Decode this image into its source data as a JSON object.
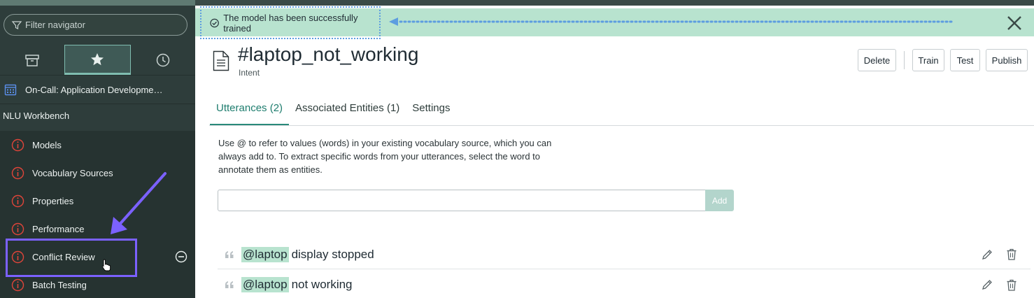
{
  "sidebar": {
    "filter_placeholder": "Filter navigator",
    "oncall_label": "On-Call: Application Developme…",
    "section_title": "NLU Workbench",
    "items": [
      {
        "label": "Models"
      },
      {
        "label": "Vocabulary Sources"
      },
      {
        "label": "Properties"
      },
      {
        "label": "Performance"
      },
      {
        "label": "Conflict Review"
      },
      {
        "label": "Batch Testing"
      }
    ]
  },
  "toast": {
    "message": "The model has been successfully trained"
  },
  "header": {
    "title": "#laptop_not_working",
    "subtitle": "Intent",
    "buttons": {
      "delete": "Delete",
      "train": "Train",
      "test": "Test",
      "publish": "Publish"
    }
  },
  "tabs": [
    {
      "label": "Utterances (2)",
      "active": true
    },
    {
      "label": "Associated Entities (1)",
      "active": false
    },
    {
      "label": "Settings",
      "active": false
    }
  ],
  "help_text": "Use @ to refer to values (words) in your existing vocabulary source, which you can always add to. To extract specific words from your utterances, select the word to annotate them as entities.",
  "add_button": "Add",
  "utterances": [
    {
      "entity": "@laptop",
      "text": "display stopped"
    },
    {
      "entity": "@laptop",
      "text": "not working"
    }
  ],
  "colors": {
    "sidebar_bg": "#2e3d3b",
    "accent": "#2a8a7a",
    "toast_bg": "#b8e3cf",
    "error_icon": "#e0453a",
    "annotation": "#7b61ff"
  }
}
